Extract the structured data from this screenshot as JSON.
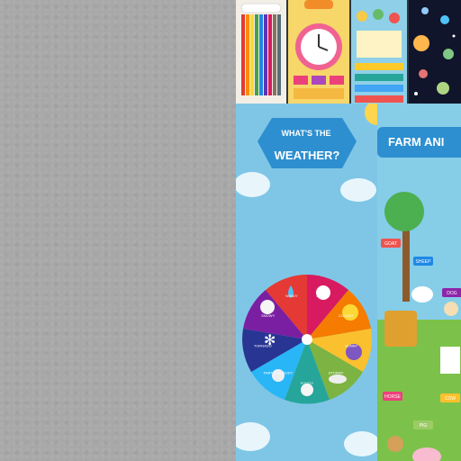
{
  "weather_poster": {
    "title_line1": "WHAT'S THE",
    "title_line2": "WEATHER?",
    "segments": [
      "SUNNY",
      "CLOUDY",
      "SUNNY",
      "STORMY",
      "FOGGY",
      "PARTLY CLOUDY",
      "TORNADO",
      "SNOWY",
      "WINDY"
    ]
  },
  "farm_poster": {
    "title": "FARM ANI",
    "labels": [
      "GOAT",
      "SHEEP",
      "DOG",
      "HORSE",
      "COW",
      "PIG"
    ]
  },
  "colors": {
    "wall": "#a8a8a8",
    "weather_bg": "#7fc6e6",
    "title_badge": "#2d8fd0"
  }
}
